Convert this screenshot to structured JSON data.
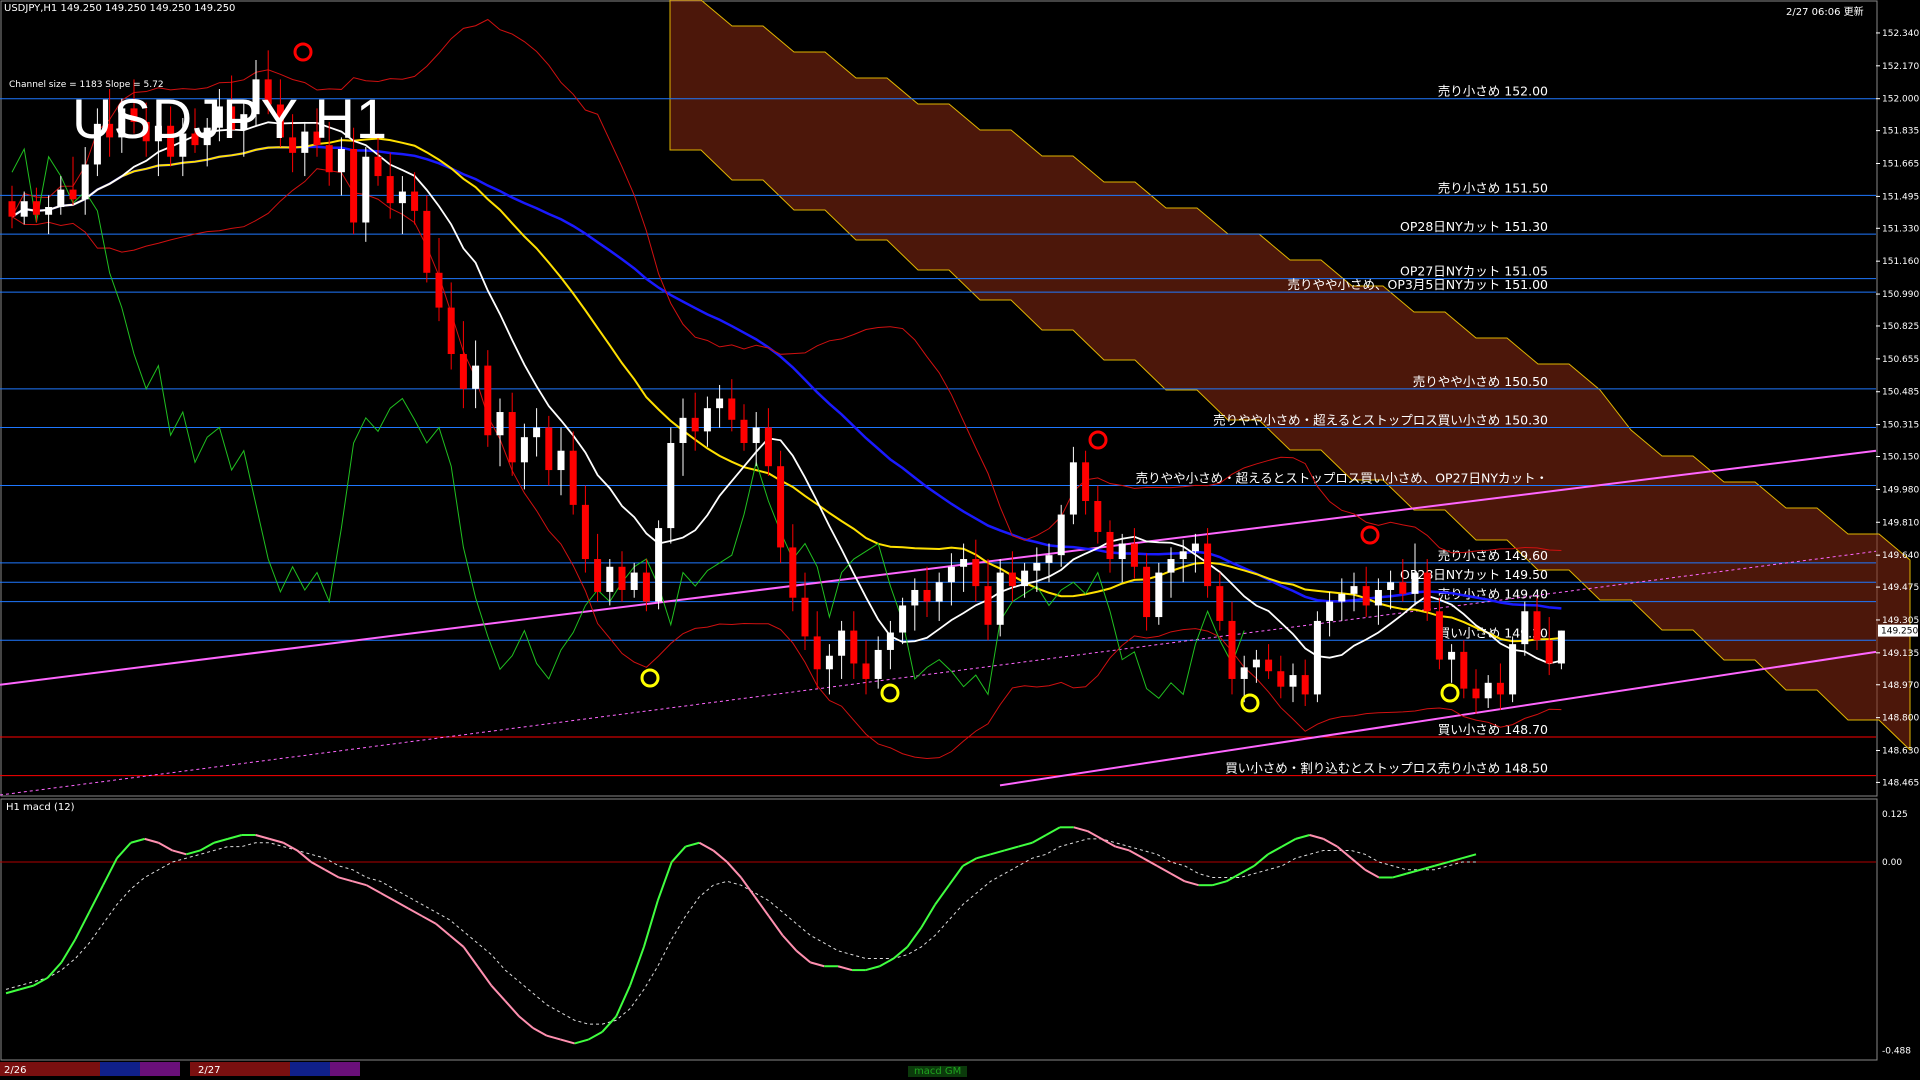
{
  "header": {
    "symbol_info": "USDJPY,H1  149.250 149.250 149.250 149.250",
    "timestamp": "2/27 06:06 更新",
    "title": "USDJPY H1",
    "channel_info": "Channel size = 1183  Slope = 5.72"
  },
  "macd_panel": {
    "label": "H1  macd (12)",
    "tab": "macd GM"
  },
  "colors": {
    "background": "#000000",
    "candle_up": "#ffffff",
    "candle_down": "#ff0000",
    "ma_white": "#ffffff",
    "ma_yellow": "#ffe000",
    "ma_blue": "#1a1aff",
    "ichimoku_cloud": "#8b2a12",
    "level_line": "#1f78ff",
    "support_line": "#ff0000",
    "channel_line": "#ff66ff",
    "lagging_span": "#20c020",
    "bollinger": "#d01010",
    "macd_up": "#40ff40",
    "macd_down": "#ff90b0"
  },
  "chart_data": {
    "type": "line",
    "title": "USDJPY H1",
    "ylim": [
      148.4,
      152.5
    ],
    "yaxis_ticks": [
      "152.340",
      "152.170",
      "152.000",
      "151.835",
      "151.665",
      "151.495",
      "151.330",
      "151.160",
      "150.990",
      "150.825",
      "150.655",
      "150.485",
      "150.315",
      "150.150",
      "149.980",
      "149.810",
      "149.640",
      "149.475",
      "149.305",
      "149.135",
      "148.970",
      "148.800",
      "148.630",
      "148.465"
    ],
    "current_price": "149.250",
    "date_labels": [
      "2/26",
      "2/27"
    ],
    "price_levels": [
      {
        "label": "売り小さめ 152.00",
        "value": 152.0
      },
      {
        "label": "売り小さめ 151.50",
        "value": 151.5
      },
      {
        "label": "OP28日NYカット 151.30",
        "value": 151.3
      },
      {
        "label": "OP27日NYカット 151.05",
        "value": 151.07
      },
      {
        "label": "売りやや小さめ、OP3月5日NYカット 151.00",
        "value": 151.0
      },
      {
        "label": "売りやや小さめ 150.50",
        "value": 150.5
      },
      {
        "label": "売りやや小さめ・超えるとストップロス買い小さめ 150.30",
        "value": 150.3
      },
      {
        "label": "売りやや小さめ・超えるとストップロス買い小さめ、OP27日NYカット・",
        "value": 150.0
      },
      {
        "label": "売り小さめ 149.60",
        "value": 149.6
      },
      {
        "label": "OP28日NYカット 149.50",
        "value": 149.5
      },
      {
        "label": "売り小さめ 149.40",
        "value": 149.4
      },
      {
        "label": "買い小さめ 149.20",
        "value": 149.2
      },
      {
        "label": "買い小さめ 148.70",
        "value": 148.7
      },
      {
        "label": "買い小さめ・割り込むとストップロス売り小さめ 148.50",
        "value": 148.5
      }
    ],
    "candles": [
      {
        "o": 151.47,
        "h": 151.55,
        "l": 151.33,
        "c": 151.39
      },
      {
        "o": 151.39,
        "h": 151.52,
        "l": 151.35,
        "c": 151.47
      },
      {
        "o": 151.47,
        "h": 151.54,
        "l": 151.36,
        "c": 151.4
      },
      {
        "o": 151.4,
        "h": 151.5,
        "l": 151.3,
        "c": 151.44
      },
      {
        "o": 151.44,
        "h": 151.6,
        "l": 151.4,
        "c": 151.53
      },
      {
        "o": 151.53,
        "h": 151.7,
        "l": 151.45,
        "c": 151.48
      },
      {
        "o": 151.48,
        "h": 151.75,
        "l": 151.4,
        "c": 151.66
      },
      {
        "o": 151.66,
        "h": 151.95,
        "l": 151.6,
        "c": 151.87
      },
      {
        "o": 151.87,
        "h": 152.05,
        "l": 151.7,
        "c": 151.8
      },
      {
        "o": 151.8,
        "h": 152.0,
        "l": 151.72,
        "c": 151.95
      },
      {
        "o": 151.95,
        "h": 152.1,
        "l": 151.82,
        "c": 151.88
      },
      {
        "o": 151.88,
        "h": 151.98,
        "l": 151.7,
        "c": 151.78
      },
      {
        "o": 151.78,
        "h": 151.92,
        "l": 151.6,
        "c": 151.86
      },
      {
        "o": 151.86,
        "h": 151.96,
        "l": 151.65,
        "c": 151.7
      },
      {
        "o": 151.7,
        "h": 151.9,
        "l": 151.6,
        "c": 151.82
      },
      {
        "o": 151.82,
        "h": 151.95,
        "l": 151.72,
        "c": 151.76
      },
      {
        "o": 151.76,
        "h": 151.9,
        "l": 151.65,
        "c": 151.85
      },
      {
        "o": 151.85,
        "h": 152.05,
        "l": 151.78,
        "c": 151.96
      },
      {
        "o": 151.96,
        "h": 152.12,
        "l": 151.8,
        "c": 151.84
      },
      {
        "o": 151.84,
        "h": 151.98,
        "l": 151.7,
        "c": 151.92
      },
      {
        "o": 151.92,
        "h": 152.2,
        "l": 151.86,
        "c": 152.1
      },
      {
        "o": 152.1,
        "h": 152.25,
        "l": 151.92,
        "c": 151.97
      },
      {
        "o": 151.97,
        "h": 152.1,
        "l": 151.75,
        "c": 151.8
      },
      {
        "o": 151.8,
        "h": 151.92,
        "l": 151.62,
        "c": 151.72
      },
      {
        "o": 151.72,
        "h": 151.88,
        "l": 151.6,
        "c": 151.83
      },
      {
        "o": 151.83,
        "h": 151.95,
        "l": 151.7,
        "c": 151.76
      },
      {
        "o": 151.76,
        "h": 151.88,
        "l": 151.55,
        "c": 151.62
      },
      {
        "o": 151.62,
        "h": 151.8,
        "l": 151.5,
        "c": 151.74
      },
      {
        "o": 151.74,
        "h": 151.85,
        "l": 151.3,
        "c": 151.36
      },
      {
        "o": 151.36,
        "h": 151.75,
        "l": 151.26,
        "c": 151.7
      },
      {
        "o": 151.7,
        "h": 151.82,
        "l": 151.55,
        "c": 151.6
      },
      {
        "o": 151.6,
        "h": 151.72,
        "l": 151.38,
        "c": 151.46
      },
      {
        "o": 151.46,
        "h": 151.6,
        "l": 151.3,
        "c": 151.52
      },
      {
        "o": 151.52,
        "h": 151.62,
        "l": 151.35,
        "c": 151.42
      },
      {
        "o": 151.42,
        "h": 151.5,
        "l": 151.05,
        "c": 151.1
      },
      {
        "o": 151.1,
        "h": 151.28,
        "l": 150.85,
        "c": 150.92
      },
      {
        "o": 150.92,
        "h": 151.05,
        "l": 150.6,
        "c": 150.68
      },
      {
        "o": 150.68,
        "h": 150.85,
        "l": 150.4,
        "c": 150.5
      },
      {
        "o": 150.5,
        "h": 150.75,
        "l": 150.4,
        "c": 150.62
      },
      {
        "o": 150.62,
        "h": 150.7,
        "l": 150.2,
        "c": 150.26
      },
      {
        "o": 150.26,
        "h": 150.45,
        "l": 150.1,
        "c": 150.38
      },
      {
        "o": 150.38,
        "h": 150.48,
        "l": 150.05,
        "c": 150.12
      },
      {
        "o": 150.12,
        "h": 150.32,
        "l": 149.98,
        "c": 150.25
      },
      {
        "o": 150.25,
        "h": 150.4,
        "l": 150.15,
        "c": 150.3
      },
      {
        "o": 150.3,
        "h": 150.36,
        "l": 150.0,
        "c": 150.08
      },
      {
        "o": 150.08,
        "h": 150.3,
        "l": 149.95,
        "c": 150.18
      },
      {
        "o": 150.18,
        "h": 150.28,
        "l": 149.85,
        "c": 149.9
      },
      {
        "o": 149.9,
        "h": 150.0,
        "l": 149.55,
        "c": 149.62
      },
      {
        "o": 149.62,
        "h": 149.75,
        "l": 149.4,
        "c": 149.45
      },
      {
        "o": 149.45,
        "h": 149.62,
        "l": 149.38,
        "c": 149.58
      },
      {
        "o": 149.58,
        "h": 149.66,
        "l": 149.4,
        "c": 149.46
      },
      {
        "o": 149.46,
        "h": 149.6,
        "l": 149.42,
        "c": 149.55
      },
      {
        "o": 149.55,
        "h": 149.62,
        "l": 149.35,
        "c": 149.4
      },
      {
        "o": 149.4,
        "h": 149.82,
        "l": 149.36,
        "c": 149.78
      },
      {
        "o": 149.78,
        "h": 150.3,
        "l": 149.7,
        "c": 150.22
      },
      {
        "o": 150.22,
        "h": 150.45,
        "l": 150.05,
        "c": 150.35
      },
      {
        "o": 150.35,
        "h": 150.48,
        "l": 150.18,
        "c": 150.28
      },
      {
        "o": 150.28,
        "h": 150.46,
        "l": 150.2,
        "c": 150.4
      },
      {
        "o": 150.4,
        "h": 150.52,
        "l": 150.3,
        "c": 150.45
      },
      {
        "o": 150.45,
        "h": 150.55,
        "l": 150.28,
        "c": 150.34
      },
      {
        "o": 150.34,
        "h": 150.42,
        "l": 150.18,
        "c": 150.22
      },
      {
        "o": 150.22,
        "h": 150.38,
        "l": 150.1,
        "c": 150.3
      },
      {
        "o": 150.3,
        "h": 150.4,
        "l": 150.05,
        "c": 150.1
      },
      {
        "o": 150.1,
        "h": 150.18,
        "l": 149.6,
        "c": 149.68
      },
      {
        "o": 149.68,
        "h": 149.8,
        "l": 149.35,
        "c": 149.42
      },
      {
        "o": 149.42,
        "h": 149.55,
        "l": 149.15,
        "c": 149.22
      },
      {
        "o": 149.22,
        "h": 149.35,
        "l": 148.95,
        "c": 149.05
      },
      {
        "o": 149.05,
        "h": 149.18,
        "l": 148.92,
        "c": 149.12
      },
      {
        "o": 149.12,
        "h": 149.3,
        "l": 149.0,
        "c": 149.25
      },
      {
        "o": 149.25,
        "h": 149.35,
        "l": 149.0,
        "c": 149.08
      },
      {
        "o": 149.08,
        "h": 149.2,
        "l": 148.92,
        "c": 149.0
      },
      {
        "o": 149.0,
        "h": 149.22,
        "l": 148.95,
        "c": 149.15
      },
      {
        "o": 149.15,
        "h": 149.3,
        "l": 149.05,
        "c": 149.24
      },
      {
        "o": 149.24,
        "h": 149.42,
        "l": 149.18,
        "c": 149.38
      },
      {
        "o": 149.38,
        "h": 149.52,
        "l": 149.25,
        "c": 149.46
      },
      {
        "o": 149.46,
        "h": 149.58,
        "l": 149.32,
        "c": 149.4
      },
      {
        "o": 149.4,
        "h": 149.55,
        "l": 149.3,
        "c": 149.5
      },
      {
        "o": 149.5,
        "h": 149.65,
        "l": 149.38,
        "c": 149.58
      },
      {
        "o": 149.58,
        "h": 149.7,
        "l": 149.45,
        "c": 149.62
      },
      {
        "o": 149.62,
        "h": 149.72,
        "l": 149.4,
        "c": 149.48
      },
      {
        "o": 149.48,
        "h": 149.62,
        "l": 149.2,
        "c": 149.28
      },
      {
        "o": 149.28,
        "h": 149.62,
        "l": 149.22,
        "c": 149.55
      },
      {
        "o": 149.55,
        "h": 149.66,
        "l": 149.4,
        "c": 149.48
      },
      {
        "o": 149.48,
        "h": 149.6,
        "l": 149.42,
        "c": 149.56
      },
      {
        "o": 149.56,
        "h": 149.68,
        "l": 149.45,
        "c": 149.6
      },
      {
        "o": 149.6,
        "h": 149.7,
        "l": 149.5,
        "c": 149.64
      },
      {
        "o": 149.64,
        "h": 149.9,
        "l": 149.58,
        "c": 149.85
      },
      {
        "o": 149.85,
        "h": 150.2,
        "l": 149.8,
        "c": 150.12
      },
      {
        "o": 150.12,
        "h": 150.18,
        "l": 149.85,
        "c": 149.92
      },
      {
        "o": 149.92,
        "h": 150.0,
        "l": 149.7,
        "c": 149.76
      },
      {
        "o": 149.76,
        "h": 149.82,
        "l": 149.55,
        "c": 149.62
      },
      {
        "o": 149.62,
        "h": 149.75,
        "l": 149.5,
        "c": 149.7
      },
      {
        "o": 149.7,
        "h": 149.78,
        "l": 149.52,
        "c": 149.58
      },
      {
        "o": 149.58,
        "h": 149.65,
        "l": 149.25,
        "c": 149.32
      },
      {
        "o": 149.32,
        "h": 149.6,
        "l": 149.28,
        "c": 149.55
      },
      {
        "o": 149.55,
        "h": 149.68,
        "l": 149.42,
        "c": 149.62
      },
      {
        "o": 149.62,
        "h": 149.72,
        "l": 149.5,
        "c": 149.66
      },
      {
        "o": 149.66,
        "h": 149.75,
        "l": 149.55,
        "c": 149.7
      },
      {
        "o": 149.7,
        "h": 149.78,
        "l": 149.42,
        "c": 149.48
      },
      {
        "o": 149.48,
        "h": 149.55,
        "l": 149.25,
        "c": 149.3
      },
      {
        "o": 149.3,
        "h": 149.4,
        "l": 148.92,
        "c": 149.0
      },
      {
        "o": 149.0,
        "h": 149.12,
        "l": 148.88,
        "c": 149.06
      },
      {
        "o": 149.06,
        "h": 149.15,
        "l": 148.98,
        "c": 149.1
      },
      {
        "o": 149.1,
        "h": 149.18,
        "l": 149.0,
        "c": 149.04
      },
      {
        "o": 149.04,
        "h": 149.12,
        "l": 148.9,
        "c": 148.96
      },
      {
        "o": 148.96,
        "h": 149.08,
        "l": 148.88,
        "c": 149.02
      },
      {
        "o": 149.02,
        "h": 149.1,
        "l": 148.86,
        "c": 148.92
      },
      {
        "o": 148.92,
        "h": 149.35,
        "l": 148.88,
        "c": 149.3
      },
      {
        "o": 149.3,
        "h": 149.45,
        "l": 149.22,
        "c": 149.4
      },
      {
        "o": 149.4,
        "h": 149.52,
        "l": 149.3,
        "c": 149.44
      },
      {
        "o": 149.44,
        "h": 149.55,
        "l": 149.35,
        "c": 149.48
      },
      {
        "o": 149.48,
        "h": 149.58,
        "l": 149.32,
        "c": 149.38
      },
      {
        "o": 149.38,
        "h": 149.52,
        "l": 149.28,
        "c": 149.46
      },
      {
        "o": 149.46,
        "h": 149.56,
        "l": 149.36,
        "c": 149.5
      },
      {
        "o": 149.5,
        "h": 149.62,
        "l": 149.4,
        "c": 149.44
      },
      {
        "o": 149.44,
        "h": 149.7,
        "l": 149.38,
        "c": 149.55
      },
      {
        "o": 149.55,
        "h": 149.62,
        "l": 149.3,
        "c": 149.35
      },
      {
        "o": 149.35,
        "h": 149.42,
        "l": 149.05,
        "c": 149.1
      },
      {
        "o": 149.1,
        "h": 149.18,
        "l": 148.98,
        "c": 149.14
      },
      {
        "o": 149.14,
        "h": 149.2,
        "l": 148.9,
        "c": 148.95
      },
      {
        "o": 148.95,
        "h": 149.05,
        "l": 148.82,
        "c": 148.9
      },
      {
        "o": 148.9,
        "h": 149.02,
        "l": 148.85,
        "c": 148.98
      },
      {
        "o": 148.98,
        "h": 149.08,
        "l": 148.84,
        "c": 148.92
      },
      {
        "o": 148.92,
        "h": 149.22,
        "l": 148.88,
        "c": 149.18
      },
      {
        "o": 149.18,
        "h": 149.4,
        "l": 149.12,
        "c": 149.35
      },
      {
        "o": 149.35,
        "h": 149.42,
        "l": 149.15,
        "c": 149.2
      },
      {
        "o": 149.2,
        "h": 149.32,
        "l": 149.02,
        "c": 149.08
      },
      {
        "o": 149.08,
        "h": 149.25,
        "l": 149.05,
        "c": 149.25
      }
    ],
    "macd_axis_ticks": [
      "0.125",
      "0.00",
      "-0.488"
    ],
    "macd_ylim": [
      -0.5,
      0.14
    ],
    "macd": [
      -0.34,
      -0.33,
      -0.32,
      -0.3,
      -0.26,
      -0.2,
      -0.13,
      -0.06,
      0.01,
      0.05,
      0.06,
      0.05,
      0.03,
      0.02,
      0.03,
      0.05,
      0.06,
      0.07,
      0.07,
      0.06,
      0.05,
      0.03,
      0.0,
      -0.02,
      -0.04,
      -0.05,
      -0.06,
      -0.08,
      -0.1,
      -0.12,
      -0.14,
      -0.16,
      -0.19,
      -0.22,
      -0.27,
      -0.32,
      -0.36,
      -0.4,
      -0.43,
      -0.45,
      -0.46,
      -0.47,
      -0.46,
      -0.44,
      -0.4,
      -0.32,
      -0.22,
      -0.1,
      0.0,
      0.04,
      0.05,
      0.03,
      0.0,
      -0.04,
      -0.09,
      -0.14,
      -0.19,
      -0.23,
      -0.26,
      -0.27,
      -0.27,
      -0.28,
      -0.28,
      -0.27,
      -0.25,
      -0.22,
      -0.17,
      -0.11,
      -0.06,
      -0.01,
      0.01,
      0.02,
      0.03,
      0.04,
      0.05,
      0.07,
      0.09,
      0.09,
      0.08,
      0.06,
      0.04,
      0.03,
      0.01,
      -0.01,
      -0.03,
      -0.05,
      -0.06,
      -0.06,
      -0.05,
      -0.03,
      -0.01,
      0.02,
      0.04,
      0.06,
      0.07,
      0.06,
      0.04,
      0.01,
      -0.02,
      -0.04,
      -0.04,
      -0.03,
      -0.02,
      -0.01,
      0.0,
      0.01,
      0.02
    ],
    "macd_signal": [
      -0.33,
      -0.32,
      -0.31,
      -0.3,
      -0.28,
      -0.25,
      -0.21,
      -0.16,
      -0.11,
      -0.07,
      -0.04,
      -0.02,
      0.0,
      0.01,
      0.02,
      0.03,
      0.04,
      0.04,
      0.05,
      0.05,
      0.04,
      0.03,
      0.02,
      0.01,
      -0.01,
      -0.02,
      -0.04,
      -0.05,
      -0.07,
      -0.09,
      -0.11,
      -0.13,
      -0.15,
      -0.18,
      -0.21,
      -0.24,
      -0.28,
      -0.31,
      -0.34,
      -0.37,
      -0.39,
      -0.41,
      -0.42,
      -0.42,
      -0.41,
      -0.38,
      -0.33,
      -0.27,
      -0.2,
      -0.14,
      -0.09,
      -0.06,
      -0.05,
      -0.06,
      -0.08,
      -0.1,
      -0.13,
      -0.16,
      -0.19,
      -0.21,
      -0.23,
      -0.24,
      -0.25,
      -0.25,
      -0.25,
      -0.24,
      -0.22,
      -0.19,
      -0.15,
      -0.11,
      -0.08,
      -0.05,
      -0.03,
      -0.01,
      0.01,
      0.02,
      0.04,
      0.05,
      0.06,
      0.06,
      0.05,
      0.04,
      0.03,
      0.02,
      0.0,
      -0.01,
      -0.03,
      -0.04,
      -0.04,
      -0.04,
      -0.03,
      -0.02,
      -0.01,
      0.01,
      0.02,
      0.03,
      0.03,
      0.03,
      0.02,
      0.0,
      -0.01,
      -0.02,
      -0.02,
      -0.02,
      -0.01,
      0.0,
      0.0
    ]
  }
}
